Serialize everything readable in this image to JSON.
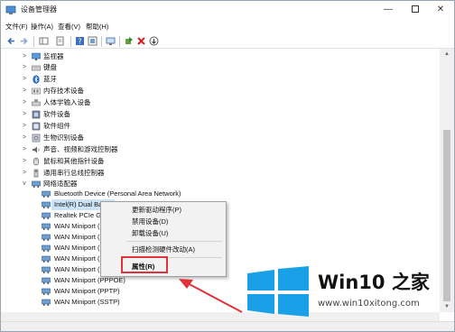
{
  "window": {
    "title": "设备管理器",
    "controls": {
      "minimize": "—",
      "close": "✕"
    }
  },
  "menu": [
    "文件(F)",
    "操作(A)",
    "查看(V)",
    "帮助(H)"
  ],
  "toolbar_icons": [
    "back-arrow-icon",
    "forward-arrow-icon",
    "show-hide-tree-icon",
    "properties-icon",
    "help-icon",
    "update-driver-icon",
    "scan-hardware-icon",
    "enable-device-icon",
    "uninstall-icon",
    "download-icon"
  ],
  "tree": {
    "categories": [
      {
        "label": "监视器",
        "icon": "monitor-icon",
        "expanded": false
      },
      {
        "label": "键盘",
        "icon": "keyboard-icon",
        "expanded": false
      },
      {
        "label": "蓝牙",
        "icon": "bluetooth-icon",
        "expanded": false
      },
      {
        "label": "内存技术设备",
        "icon": "memory-icon",
        "expanded": false
      },
      {
        "label": "人体学输入设备",
        "icon": "hid-icon",
        "expanded": false
      },
      {
        "label": "软件设备",
        "icon": "software-device-icon",
        "expanded": false
      },
      {
        "label": "软件组件",
        "icon": "software-component-icon",
        "expanded": false
      },
      {
        "label": "生物识别设备",
        "icon": "biometric-icon",
        "expanded": false
      },
      {
        "label": "声音、视频和游戏控制器",
        "icon": "audio-icon",
        "expanded": false
      },
      {
        "label": "鼠标和其他指针设备",
        "icon": "mouse-icon",
        "expanded": false
      },
      {
        "label": "通用串行总线控制器",
        "icon": "usb-icon",
        "expanded": false
      },
      {
        "label": "网络适配器",
        "icon": "network-icon",
        "expanded": true
      }
    ],
    "network_children": [
      "Bluetooth Device (Personal Area Network)",
      "Intel(R) Dual Band",
      "Realtek PCIe GBE",
      "WAN Miniport (IK",
      "WAN Miniport (IP",
      "WAN Miniport (IP",
      "WAN Miniport (L",
      "WAN Miniport (N",
      "WAN Miniport (PPPOE)",
      "WAN Miniport (PPTP)",
      "WAN Miniport (SSTP)"
    ]
  },
  "context_menu": {
    "items": [
      "更新驱动程序(P)",
      "禁用设备(D)",
      "卸载设备(U)",
      "扫描检测硬件改动(A)",
      "属性(R)"
    ]
  },
  "watermark": {
    "brand": "Win10",
    "brand_suffix": "之家",
    "url": "www.win10xitong.com"
  },
  "colors": {
    "highlight_box": "#e0323c",
    "arrow": "#e0323c",
    "logo_blue": "#1aa0e6",
    "selection": "#cce4f7"
  }
}
